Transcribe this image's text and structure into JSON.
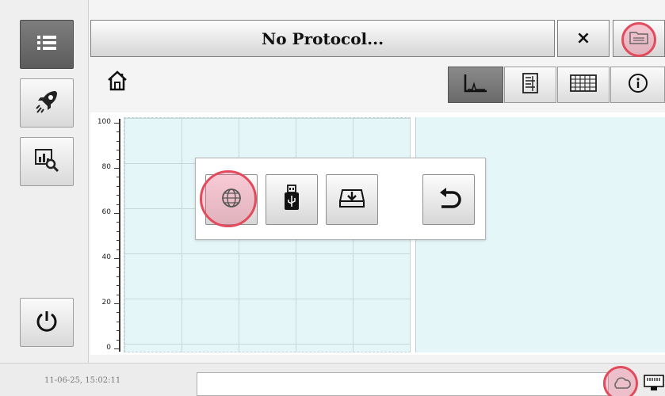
{
  "header": {
    "title": "No Protocol...",
    "close_label": "×"
  },
  "sidebar": {
    "items": [
      {
        "icon": "list-icon"
      },
      {
        "icon": "rocket-icon"
      },
      {
        "icon": "analysis-icon"
      }
    ],
    "power": {
      "icon": "power-icon"
    }
  },
  "view_tabs": [
    {
      "icon": "chart-view-icon",
      "active": true
    },
    {
      "icon": "data-view-icon"
    },
    {
      "icon": "table-view-icon"
    },
    {
      "icon": "info-icon"
    }
  ],
  "chart": {
    "y_ticks": [
      "100",
      "80",
      "60",
      "40",
      "20",
      "0"
    ]
  },
  "export_popup": {
    "buttons": [
      {
        "icon": "network-icon"
      },
      {
        "icon": "usb-icon"
      },
      {
        "icon": "save-drive-icon"
      },
      {
        "icon": "back-icon"
      }
    ]
  },
  "status": {
    "timestamp": "11-06-25, 15:02:11"
  },
  "colors": {
    "highlight_ring": "#e24b5c",
    "plot_bg": "#e4f6f8",
    "active_button": "#6a6a6a"
  }
}
